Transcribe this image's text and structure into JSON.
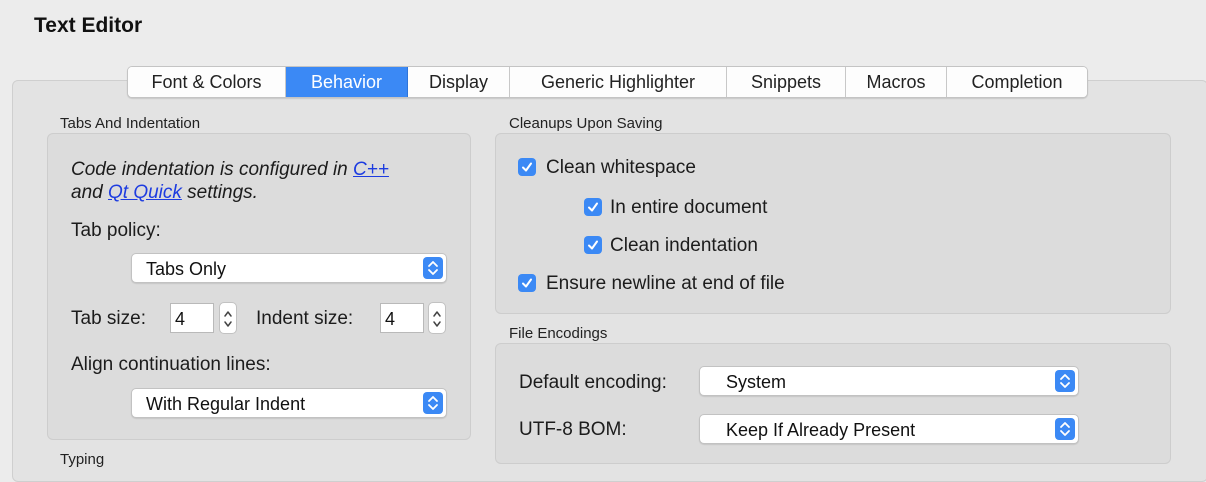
{
  "header": {
    "title": "Text Editor"
  },
  "tabs": [
    "Font & Colors",
    "Behavior",
    "Display",
    "Generic Highlighter",
    "Snippets",
    "Macros",
    "Completion"
  ],
  "active_tab": "Behavior",
  "colors": {
    "accent": "#3b89f5",
    "link": "#1d3ce0",
    "panel": "#dcdcdc",
    "background": "#ececec"
  },
  "tabs_indentation": {
    "group_title": "Tabs And Indentation",
    "info_prefix": "Code indentation is configured in ",
    "info_link1": "C++",
    "info_mid": "and ",
    "info_link2": "Qt Quick",
    "info_suffix": " settings.",
    "tab_policy_label": "Tab policy:",
    "tab_policy_value": "Tabs Only",
    "tab_size_label": "Tab size:",
    "tab_size_value": "4",
    "indent_size_label": "Indent size:",
    "indent_size_value": "4",
    "align_label": "Align continuation lines:",
    "align_value": "With Regular Indent"
  },
  "typing": {
    "group_title": "Typing"
  },
  "cleanups": {
    "group_title": "Cleanups Upon Saving",
    "clean_whitespace": {
      "label": "Clean whitespace",
      "checked": true
    },
    "entire_document": {
      "label": "In entire document",
      "checked": true
    },
    "clean_indentation": {
      "label": "Clean indentation",
      "checked": true
    },
    "ensure_newline": {
      "label": "Ensure newline at end of file",
      "checked": true
    }
  },
  "file_encodings": {
    "group_title": "File Encodings",
    "default_encoding_label": "Default encoding:",
    "default_encoding_value": "System",
    "bom_label": "UTF-8 BOM:",
    "bom_value": "Keep If Already Present"
  },
  "icons": {
    "popup_arrows": "up-down-chevrons-icon",
    "stepper": "stepper-arrows-icon",
    "checkbox": "checkmark-icon"
  }
}
